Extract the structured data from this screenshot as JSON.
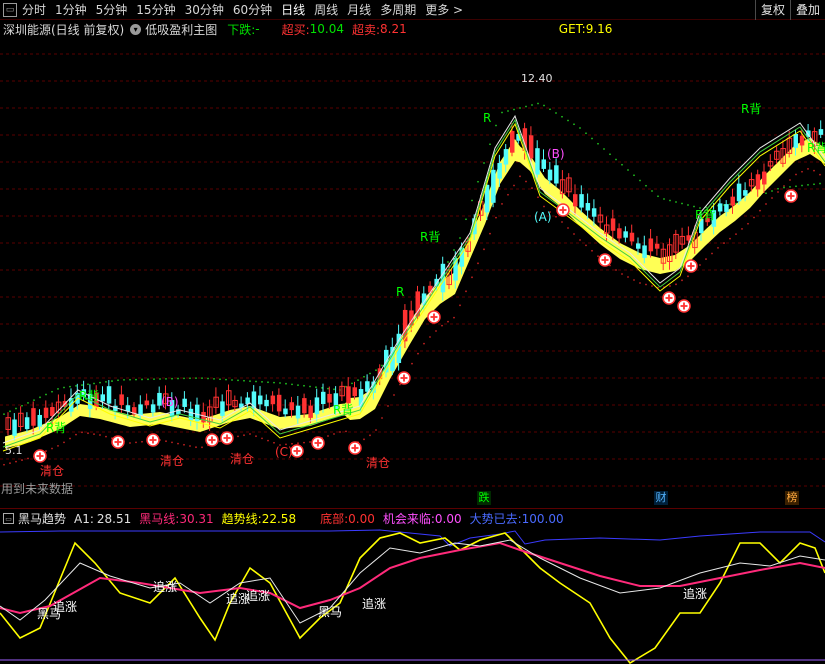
{
  "toolbar": {
    "periods": [
      "分时",
      "1分钟",
      "5分钟",
      "15分钟",
      "30分钟",
      "60分钟",
      "日线",
      "周线",
      "月线",
      "多周期"
    ],
    "active_index": 6,
    "more_label": "更多",
    "restore_label": "复权",
    "overlay_label": "叠加"
  },
  "info": {
    "stock": "深圳能源(日线 前复权)",
    "formula": "低吸盈利主图",
    "down_label": "下跌:",
    "down_value": "-",
    "buy_label": "超买:",
    "buy_value": "10.04",
    "sell_label": "超卖:",
    "sell_value": "8.21",
    "get_label": "GET:",
    "get_value": "9.16"
  },
  "main": {
    "high_label": "12.40",
    "low_label": "5.1",
    "future_note": "用到未来数据",
    "calendar_tags": [
      "跌",
      "财",
      "榜"
    ]
  },
  "sub": {
    "name": "黑马趋势",
    "a1_label": "A1:",
    "a1_value": "28.51",
    "heima_label": "黑马线:",
    "heima_value": "30.31",
    "trend_label": "趋势线:",
    "trend_value": "22.58",
    "bottom_label": "底部:",
    "bottom_value": "0.00",
    "chance_label": "机会来临:",
    "chance_value": "0.00",
    "bigtrend_label": "大势已去:",
    "bigtrend_value": "100.00",
    "annotations": [
      "黑马",
      "追涨",
      "追涨",
      "追涨",
      "追涨",
      "黑马",
      "追涨",
      "追涨"
    ]
  },
  "colors": {
    "up": "#ff3232",
    "down": "#54fcfc",
    "yellow": "#ffff00",
    "green": "#00ff00",
    "pink": "#ff2a7a",
    "blue": "#3b3bff",
    "magenta": "#ff50ff"
  },
  "chart_data": {
    "type": "candlestick",
    "title": "低吸盈利主图",
    "max_price": 12.4,
    "min_price": 5.1,
    "signals": [
      "R背",
      "R背",
      "R背",
      "R背",
      "R背",
      "R背",
      "R背",
      "R",
      "R",
      "(B)",
      "(B)",
      "(A)",
      "(C)",
      "清仓",
      "清仓",
      "清仓",
      "清仓"
    ]
  }
}
